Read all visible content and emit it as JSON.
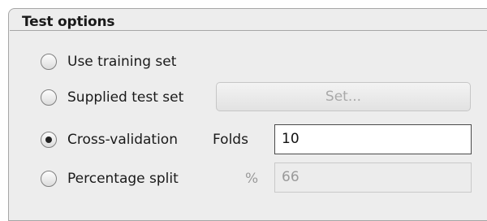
{
  "panel": {
    "title": "Test options"
  },
  "options": [
    {
      "label": "Use training set",
      "selected": false
    },
    {
      "label": "Supplied test set",
      "selected": false,
      "button_label": "Set..."
    },
    {
      "label": "Cross-validation",
      "selected": true,
      "field_label": "Folds",
      "value": "10"
    },
    {
      "label": "Percentage split",
      "selected": false,
      "field_label": "%",
      "value": "66"
    }
  ]
}
